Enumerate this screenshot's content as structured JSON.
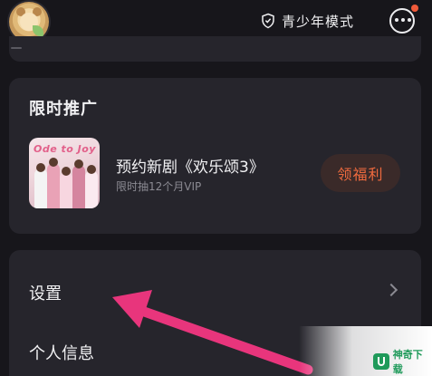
{
  "header": {
    "teen_mode_label": "青少年模式",
    "message_badge_color": "#f05a3a"
  },
  "promo": {
    "title": "限时推广",
    "poster_logo": "Ode to Joy",
    "drama_title": "预约新剧《欢乐颂3》",
    "subtitle": "限时抽12个月VIP",
    "claim_label": "领福利",
    "accent_color": "#ef6a3e"
  },
  "menu": {
    "items": [
      {
        "label": "设置",
        "icon": "chevron-right-icon"
      },
      {
        "label": "个人信息"
      }
    ]
  },
  "annotation": {
    "arrow_color": "#e8357c"
  },
  "watermark": {
    "text": "神奇下载"
  }
}
